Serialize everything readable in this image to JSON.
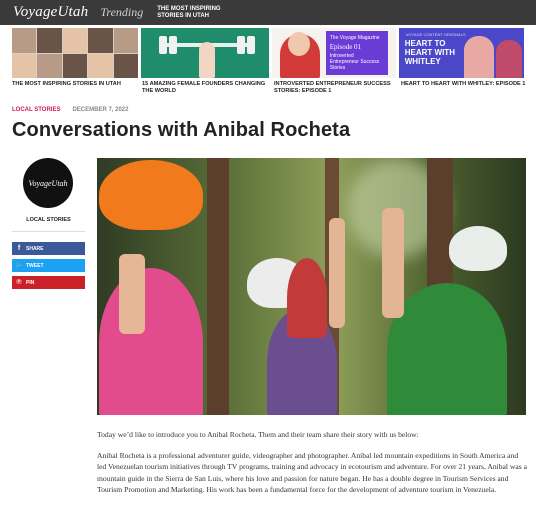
{
  "header": {
    "logo": "VoyageUtah",
    "trending_label": "Trending",
    "promo": "THE MOST INSPIRING STORIES IN UTAH"
  },
  "trending_tiles": [
    {
      "caption": "THE MOST INSPIRING STORIES IN UTAH"
    },
    {
      "caption": "15 AMAZING FEMALE FOUNDERS CHANGING THE WORLD"
    },
    {
      "caption": "INTROVERTED ENTREPRENEUR SUCCESS STORIES: EPISODE 1",
      "image_text": {
        "brand": "The Voyage Magazine",
        "episode": "Episode 01",
        "title": "Introverted Entrepreneur Success Stories"
      }
    },
    {
      "caption": "HEART TO HEART WITH WHITLEY: EPISODE 1",
      "image_text": {
        "badge": "VOYAGE CONTENT ORIGINALS",
        "title": "HEART TO HEART WITH WHITLEY"
      }
    }
  ],
  "article": {
    "category": "LOCAL STORIES",
    "date": "DECEMBER 7, 2022",
    "title": "Conversations with Anibal Rocheta",
    "intro": "Today we’d like to introduce you to Anibal Rocheta. Them and their team share their story with us below:",
    "body": "Anibal Rocheta is a professional adventurer guide, videographer and photographer. Anibal led mountain expeditions in South America and led Venezuelan tourism initiatives through TV programs, training and advocacy in ecotourism and adventure. For over 21 years, Anibal was a mountain guide in the Sierra de San Luis, where his love and passion for nature began. He has a double degree in Tourism Services and Tourism Promotion and Marketing. His work has been a fundamental force for the development of adventure tourism in Venezuela."
  },
  "sidebar": {
    "avatar_text": "VoyageUtah",
    "label": "LOCAL STORIES",
    "share": [
      {
        "label": "SHARE",
        "icon": "facebook-icon",
        "glyph": "f",
        "color": "#3b5998"
      },
      {
        "label": "TWEET",
        "icon": "twitter-icon",
        "glyph": "🐦",
        "color": "#1da1f2"
      },
      {
        "label": "PIN",
        "icon": "pinterest-icon",
        "glyph": "℗",
        "color": "#cb2027"
      }
    ]
  }
}
